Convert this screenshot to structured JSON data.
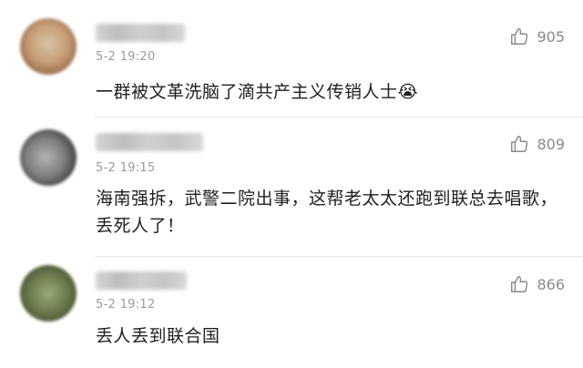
{
  "comments": [
    {
      "time": "5-2 19:20",
      "likes": "905",
      "text": "一群被文革洗脑了滴共产主义传销人士😭"
    },
    {
      "time": "5-2 19:15",
      "likes": "809",
      "text": "海南强拆，武警二院出事，这帮老太太还跑到联总去唱歌，丢死人了！"
    },
    {
      "time": "5-2 19:12",
      "likes": "866",
      "text": "丢人丢到联合国"
    }
  ]
}
